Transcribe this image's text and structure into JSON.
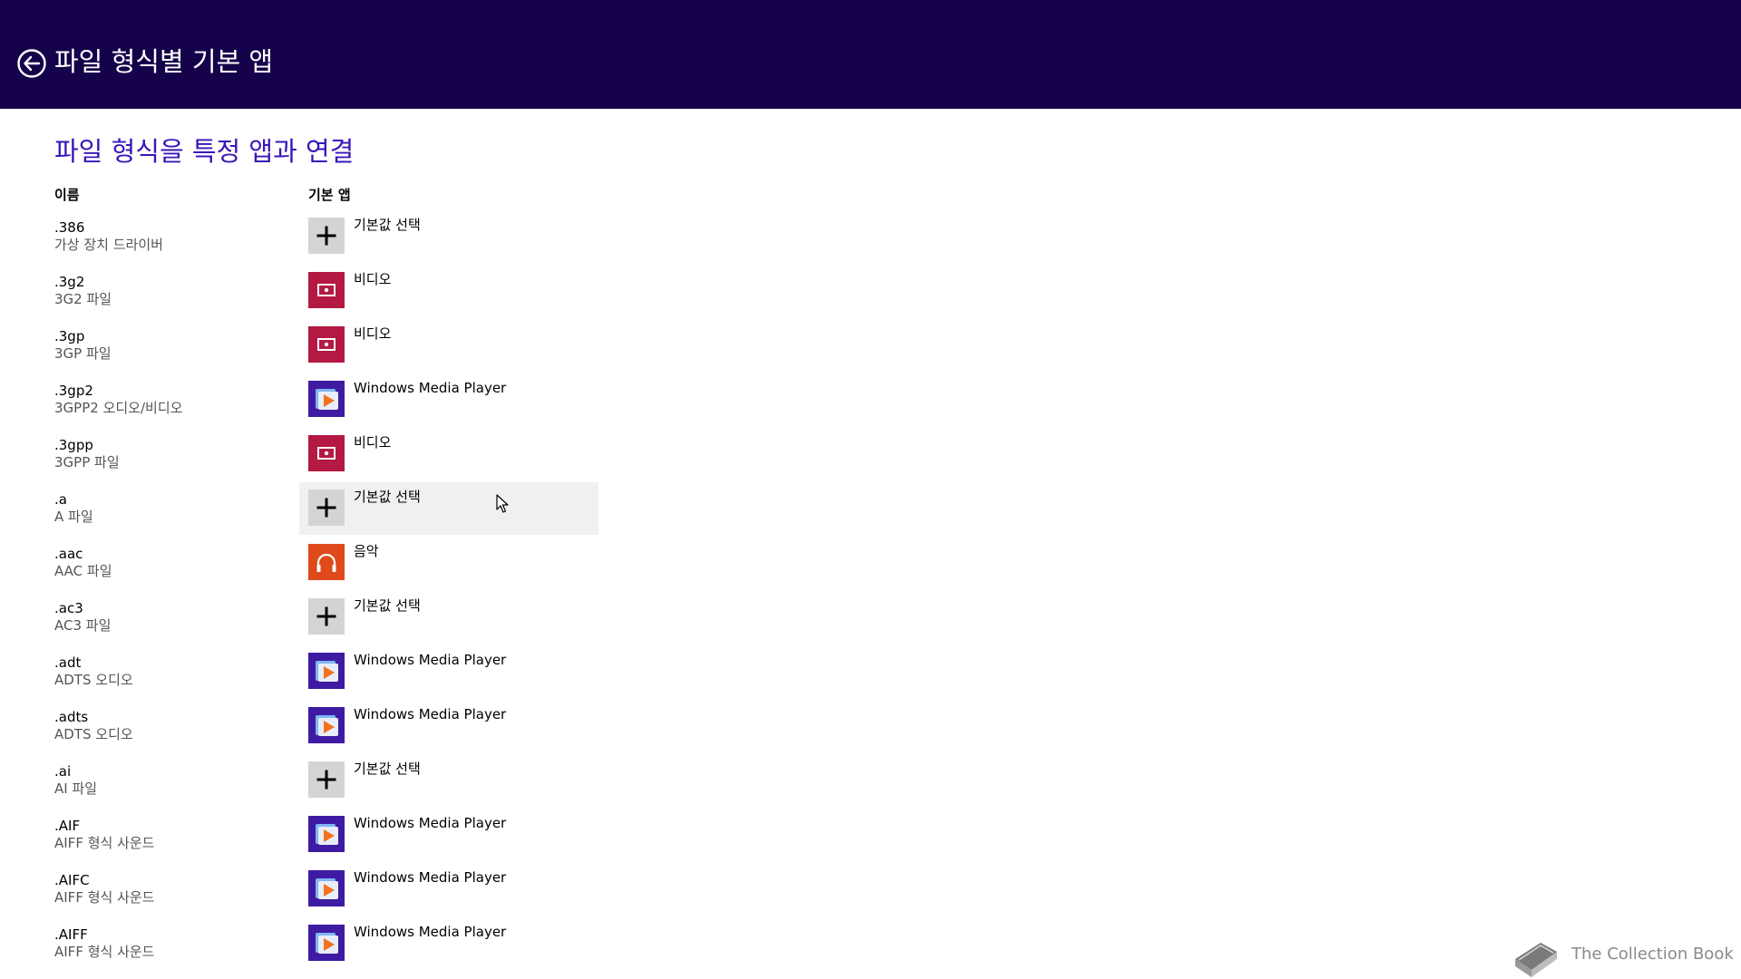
{
  "header": {
    "title": "파일 형식별 기본 앱",
    "back_icon": "back-arrow-circle-icon"
  },
  "section": {
    "title": "파일 형식을 특정 앱과 연결"
  },
  "columns": {
    "name": "이름",
    "default_app": "기본 앱"
  },
  "colors": {
    "header_bg": "#15024a",
    "accent": "#3a16b8",
    "video_tile": "#b31942",
    "wmp_tile": "#3f1ba3",
    "music_tile": "#de4a1c",
    "default_tile": "#d4d4d4"
  },
  "rows": [
    {
      "ext": ".386",
      "type": "가상 장치 드라이버",
      "app": "기본값 선택",
      "app_kind": "default"
    },
    {
      "ext": ".3g2",
      "type": "3G2 파일",
      "app": "비디오",
      "app_kind": "video"
    },
    {
      "ext": ".3gp",
      "type": "3GP 파일",
      "app": "비디오",
      "app_kind": "video"
    },
    {
      "ext": ".3gp2",
      "type": "3GPP2 오디오/비디오",
      "app": "Windows Media Player",
      "app_kind": "wmp"
    },
    {
      "ext": ".3gpp",
      "type": "3GPP 파일",
      "app": "비디오",
      "app_kind": "video"
    },
    {
      "ext": ".a",
      "type": "A 파일",
      "app": "기본값 선택",
      "app_kind": "default",
      "hovered": true
    },
    {
      "ext": ".aac",
      "type": "AAC 파일",
      "app": "음악",
      "app_kind": "music"
    },
    {
      "ext": ".ac3",
      "type": "AC3 파일",
      "app": "기본값 선택",
      "app_kind": "default"
    },
    {
      "ext": ".adt",
      "type": "ADTS 오디오",
      "app": "Windows Media Player",
      "app_kind": "wmp"
    },
    {
      "ext": ".adts",
      "type": "ADTS 오디오",
      "app": "Windows Media Player",
      "app_kind": "wmp"
    },
    {
      "ext": ".ai",
      "type": "AI 파일",
      "app": "기본값 선택",
      "app_kind": "default"
    },
    {
      "ext": ".AIF",
      "type": "AIFF 형식 사운드",
      "app": "Windows Media Player",
      "app_kind": "wmp"
    },
    {
      "ext": ".AIFC",
      "type": "AIFF 형식 사운드",
      "app": "Windows Media Player",
      "app_kind": "wmp"
    },
    {
      "ext": ".AIFF",
      "type": "AIFF 형식 사운드",
      "app": "Windows Media Player",
      "app_kind": "wmp"
    }
  ],
  "watermark": {
    "text": "The Collection Book",
    "icon": "book-icon"
  }
}
